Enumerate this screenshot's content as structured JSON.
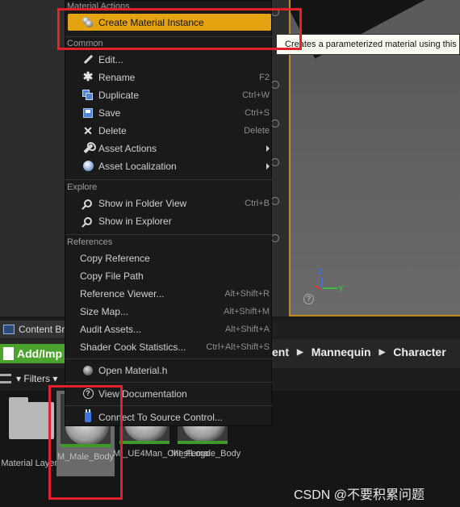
{
  "context_menu": {
    "sections": [
      {
        "header": "Material Actions",
        "items": [
          {
            "label": "Create Material Instance",
            "shortcut": "",
            "icon": "material-instance-icon",
            "highlighted": true
          }
        ]
      },
      {
        "header": "Common",
        "items": [
          {
            "label": "Edit...",
            "shortcut": "",
            "icon": "edit-icon"
          },
          {
            "label": "Rename",
            "shortcut": "F2",
            "icon": "rename-icon"
          },
          {
            "label": "Duplicate",
            "shortcut": "Ctrl+W",
            "icon": "duplicate-icon"
          },
          {
            "label": "Save",
            "shortcut": "Ctrl+S",
            "icon": "save-icon"
          },
          {
            "label": "Delete",
            "shortcut": "Delete",
            "icon": "delete-icon"
          },
          {
            "label": "Asset Actions",
            "shortcut": "",
            "icon": "wrench-icon",
            "submenu": true
          },
          {
            "label": "Asset Localization",
            "shortcut": "",
            "icon": "globe-icon",
            "submenu": true
          }
        ]
      },
      {
        "header": "Explore",
        "items": [
          {
            "label": "Show in Folder View",
            "shortcut": "Ctrl+B",
            "icon": "magnifier-icon"
          },
          {
            "label": "Show in Explorer",
            "shortcut": "",
            "icon": "magnifier-icon"
          }
        ]
      },
      {
        "header": "References",
        "items": [
          {
            "label": "Copy Reference",
            "shortcut": ""
          },
          {
            "label": "Copy File Path",
            "shortcut": ""
          },
          {
            "label": "Reference Viewer...",
            "shortcut": "Alt+Shift+R"
          },
          {
            "label": "Size Map...",
            "shortcut": "Alt+Shift+M"
          },
          {
            "label": "Audit Assets...",
            "shortcut": "Alt+Shift+A"
          },
          {
            "label": "Shader Cook Statistics...",
            "shortcut": "Ctrl+Alt+Shift+S"
          }
        ]
      }
    ],
    "extra_items": [
      {
        "label": "Open Material.h",
        "icon": "material-icon"
      },
      {
        "label": "View Documentation",
        "icon": "help-icon"
      },
      {
        "label": "Connect To Source Control...",
        "icon": "source-control-icon"
      }
    ]
  },
  "tooltip": {
    "text": "Creates a parameterized material using this"
  },
  "content_browser": {
    "tab_label": "Content Br",
    "add_import_label": "Add/Imp",
    "breadcrumbs": [
      "ent",
      "Mannequin",
      "Character"
    ],
    "filters_label": "Filters",
    "assets": [
      {
        "label": "Material Layers",
        "type": "folder"
      },
      {
        "label": "M_Male_Body",
        "type": "material",
        "selected": true
      },
      {
        "label": "MI_UE4Man_ChestLogo",
        "type": "material-instance"
      },
      {
        "label": "MI_Female_Body",
        "type": "material-instance"
      }
    ]
  },
  "viewport": {
    "axis_z": "Z",
    "axis_y": "Y",
    "help": "?"
  },
  "watermark": "CSDN @不要积累问题",
  "colors": {
    "highlight": "#e5a312",
    "annotation": "#e3202b",
    "accent_green": "#4aa32d",
    "viewport_border": "#c08a1a"
  }
}
